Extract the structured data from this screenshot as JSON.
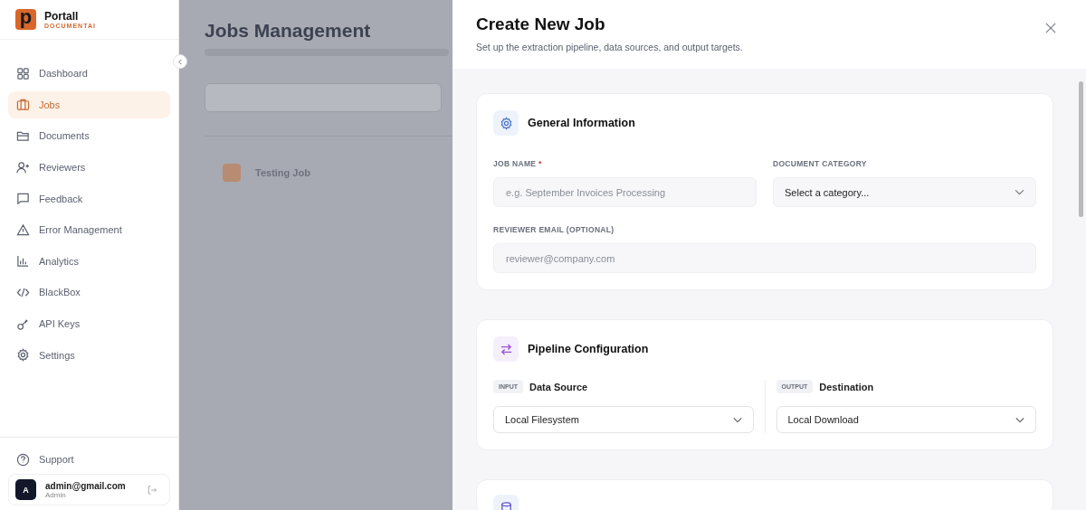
{
  "sidebar": {
    "brand": {
      "logo_letter": "p",
      "name": "Portall",
      "tagline": "DOCUMENTAI"
    },
    "nav": [
      {
        "label": "Dashboard",
        "selected": false
      },
      {
        "label": "Jobs",
        "selected": true
      },
      {
        "label": "Documents",
        "selected": false
      },
      {
        "label": "Reviewers",
        "selected": false
      },
      {
        "label": "Feedback",
        "selected": false
      },
      {
        "label": "Error Management",
        "selected": false
      },
      {
        "label": "Analytics",
        "selected": false
      },
      {
        "label": "BlackBox",
        "selected": false
      },
      {
        "label": "API Keys",
        "selected": false
      },
      {
        "label": "Settings",
        "selected": false
      }
    ],
    "support": {
      "label": "Support"
    },
    "user": {
      "avatar_letter": "A",
      "email": "admin@gmail.com",
      "role": "Admin"
    }
  },
  "background_page": {
    "title": "Jobs Management",
    "job": {
      "name": "Testing Job"
    }
  },
  "modal": {
    "title": "Create New Job",
    "subtitle": "Set up the extraction pipeline, data sources, and output targets.",
    "general": {
      "title": "General Information",
      "job_name": {
        "label": "JOB NAME",
        "required_mark": "*",
        "placeholder": "e.g. September Invoices Processing"
      },
      "category": {
        "label": "DOCUMENT CATEGORY",
        "value": "Select a category..."
      },
      "reviewer_email": {
        "label": "REVIEWER EMAIL (OPTIONAL)",
        "placeholder": "reviewer@company.com"
      }
    },
    "pipeline": {
      "title": "Pipeline Configuration",
      "source": {
        "tag": "INPUT",
        "label": "Data Source",
        "value": "Local Filesystem"
      },
      "destination": {
        "tag": "OUTPUT",
        "label": "Destination",
        "value": "Local Download"
      }
    }
  }
}
